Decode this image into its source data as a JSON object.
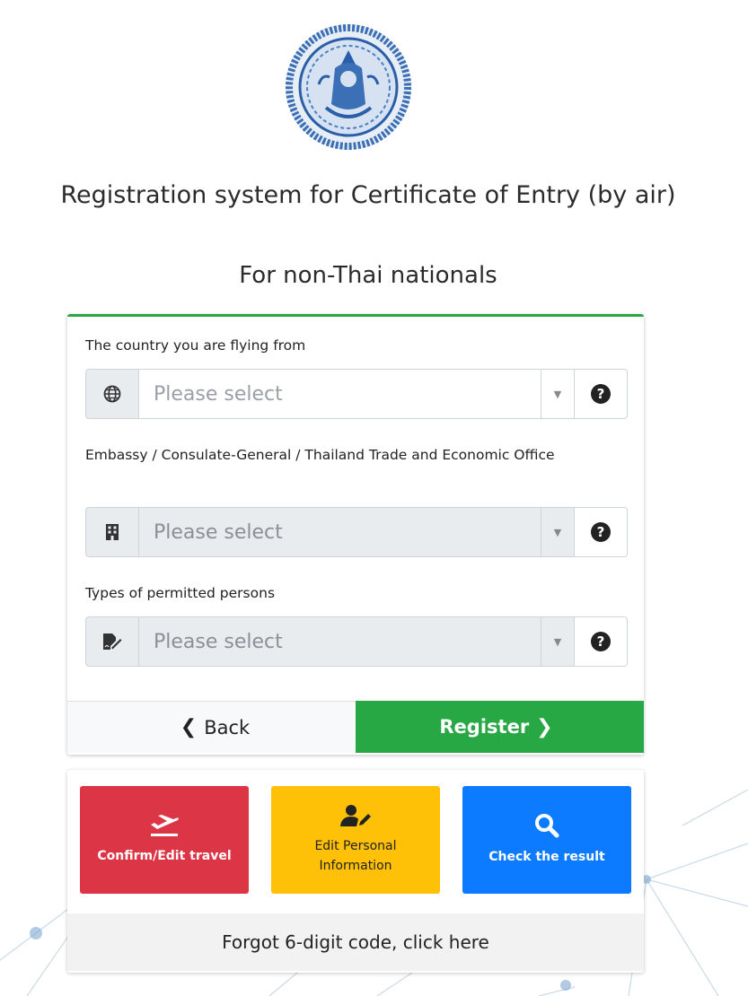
{
  "header": {
    "title": "Registration system for Certificate of Entry (by air)",
    "subtitle": "For non-Thai nationals"
  },
  "form": {
    "country": {
      "label": "The country you are flying from",
      "placeholder": "Please select",
      "icon": "globe-icon"
    },
    "embassy": {
      "label": "Embassy / Consulate-General / Thailand Trade and Economic Office",
      "placeholder": "Please select",
      "icon": "building-icon"
    },
    "person_type": {
      "label": "Types of permitted persons",
      "placeholder": "Please select",
      "icon": "file-signature-icon"
    },
    "help_glyph": "?",
    "back_label": "Back",
    "register_label": "Register"
  },
  "actions": [
    {
      "label": "Confirm/Edit travel",
      "icon": "plane-departure-icon",
      "color": "#dc3545"
    },
    {
      "label": "Edit Personal Information",
      "icon": "user-edit-icon",
      "color": "#ffc107"
    },
    {
      "label": "Check the result",
      "icon": "search-icon",
      "color": "#0d7bff"
    }
  ],
  "forgot_label": "Forgot 6-digit code, click here",
  "colors": {
    "accent": "#28a745",
    "danger": "#dc3545",
    "warning": "#ffc107",
    "primary": "#0d7bff"
  }
}
